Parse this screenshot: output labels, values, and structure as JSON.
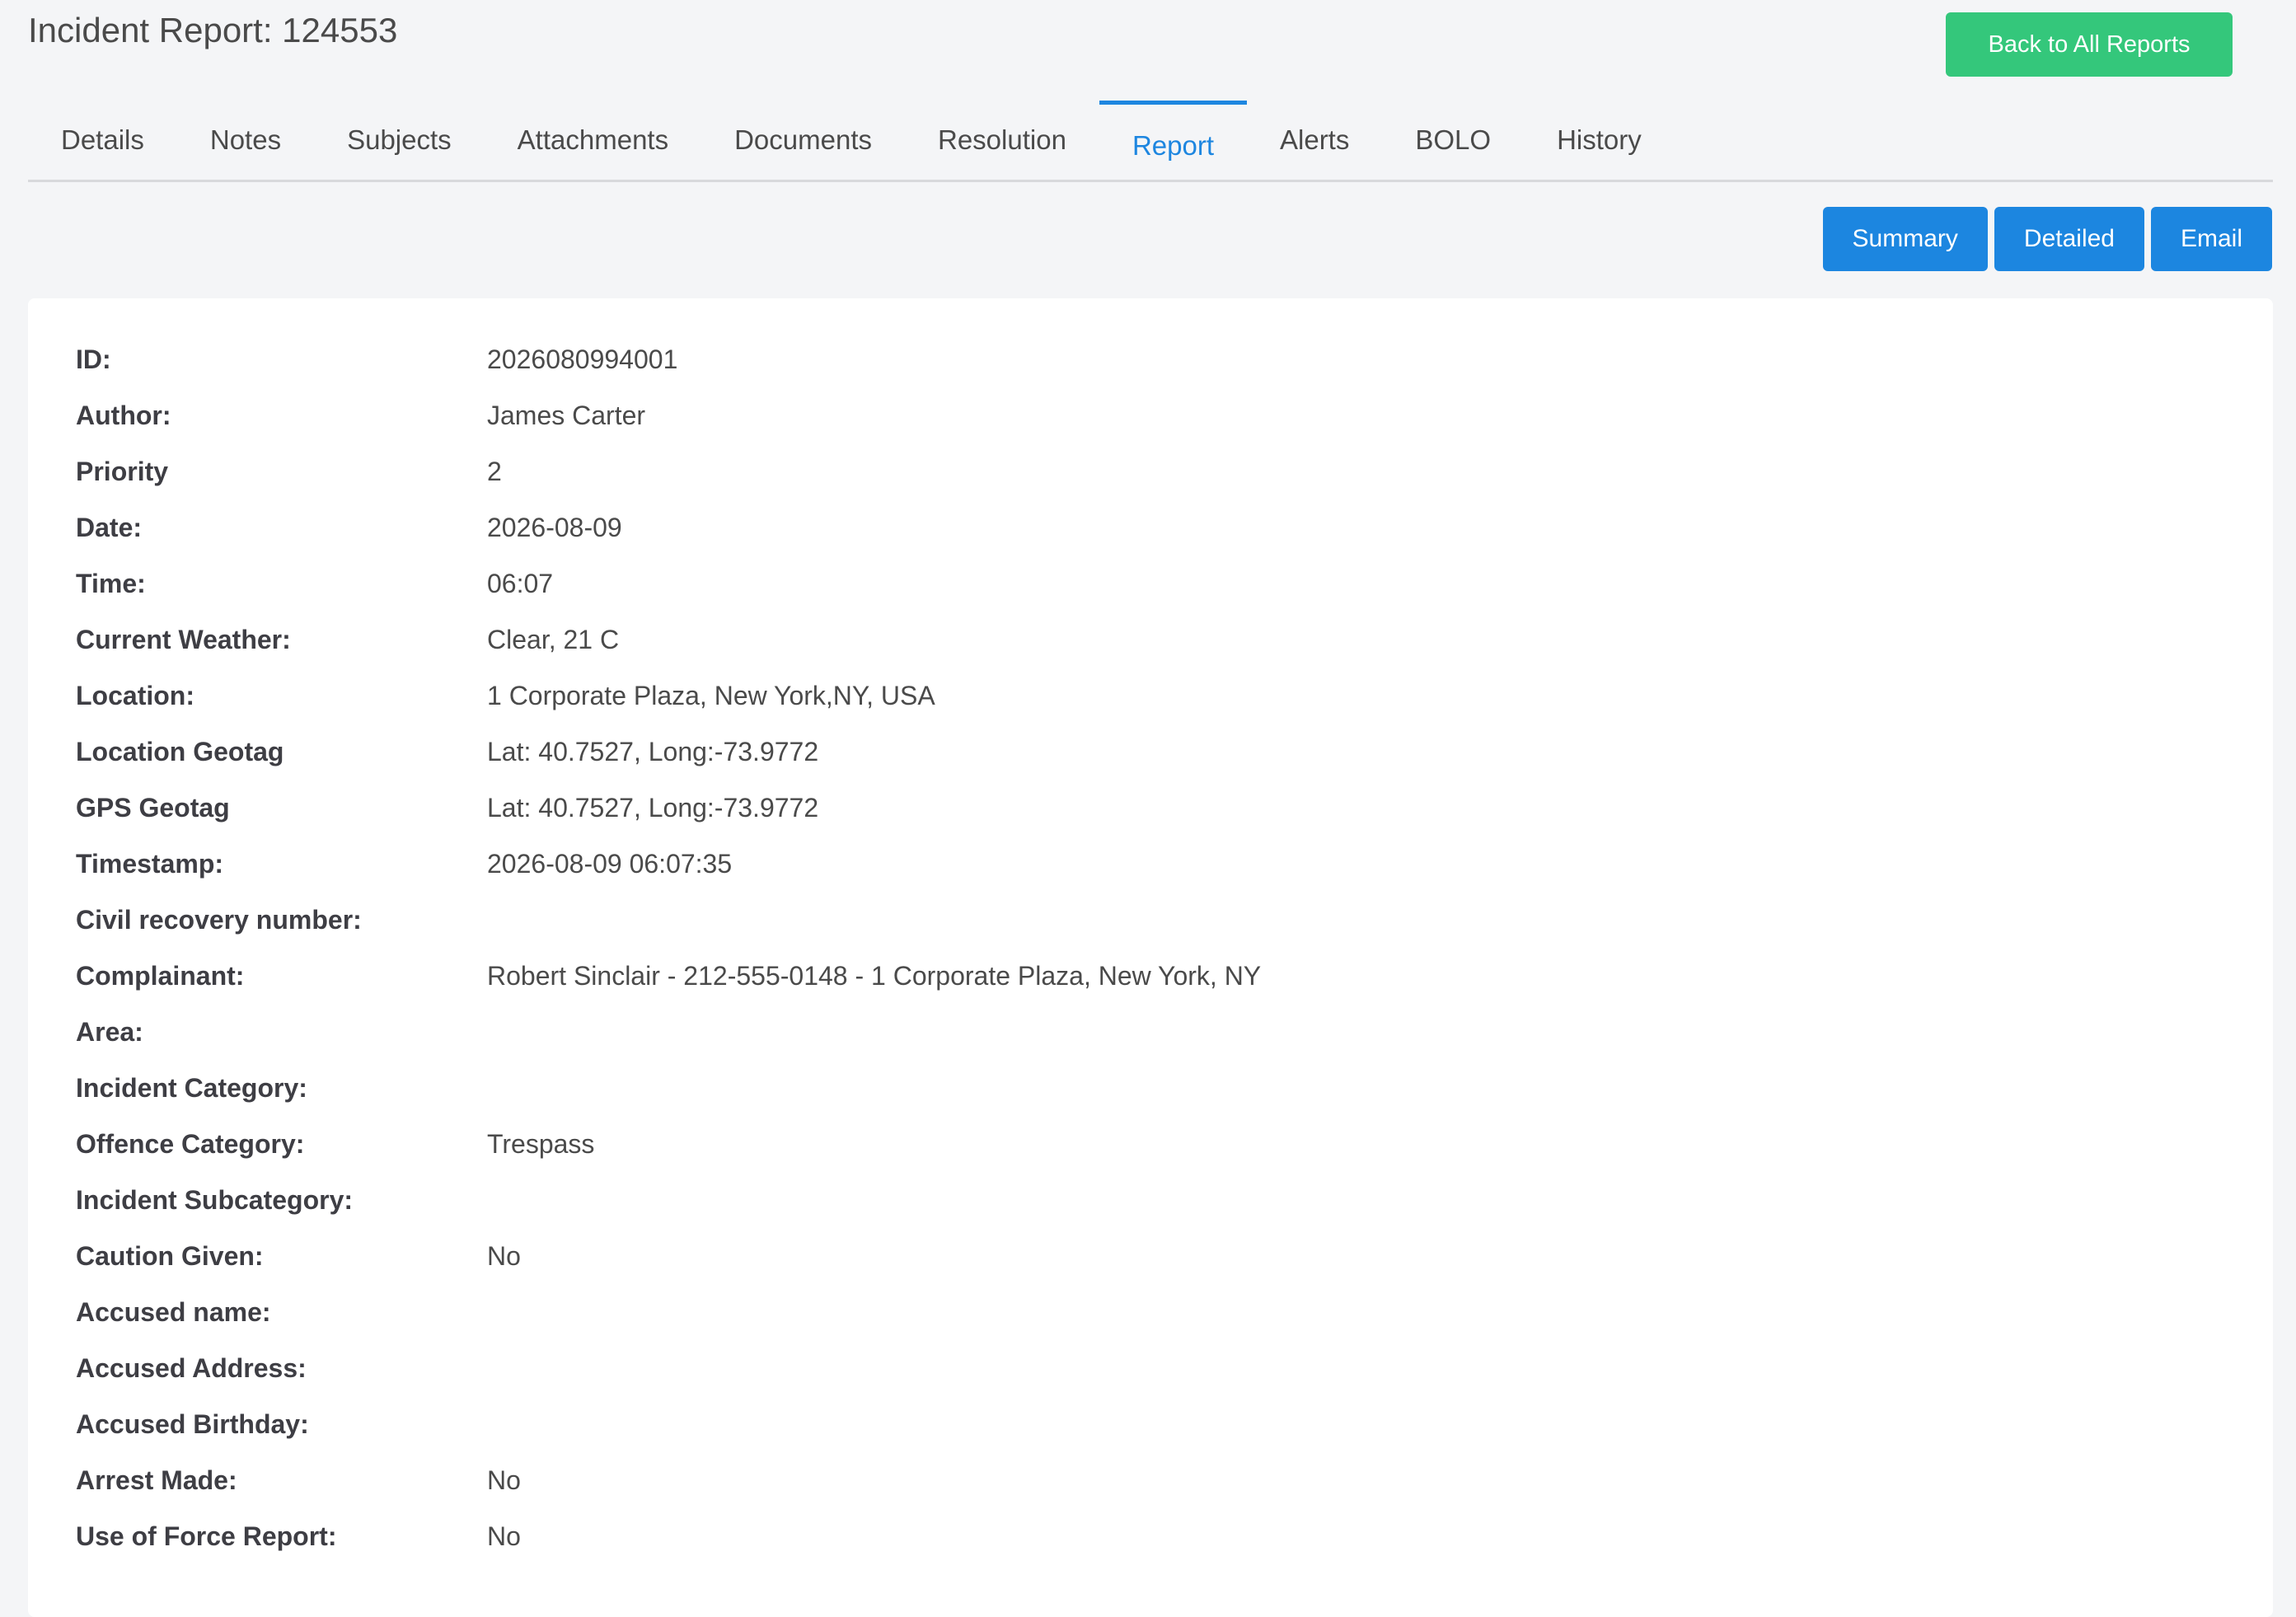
{
  "header": {
    "title": "Incident Report: 124553",
    "back_label": "Back to All Reports"
  },
  "tabs": [
    {
      "label": "Details"
    },
    {
      "label": "Notes"
    },
    {
      "label": "Subjects"
    },
    {
      "label": "Attachments"
    },
    {
      "label": "Documents"
    },
    {
      "label": "Resolution"
    },
    {
      "label": "Report",
      "active": true
    },
    {
      "label": "Alerts"
    },
    {
      "label": "BOLO"
    },
    {
      "label": "History"
    }
  ],
  "report_actions": {
    "summary": "Summary",
    "detailed": "Detailed",
    "email": "Email"
  },
  "fields": [
    {
      "label": "ID:",
      "value": "2026080994001"
    },
    {
      "label": "Author:",
      "value": "James Carter"
    },
    {
      "label": "Priority",
      "value": "2"
    },
    {
      "label": "Date:",
      "value": "2026-08-09"
    },
    {
      "label": "Time:",
      "value": "06:07"
    },
    {
      "label": "Current Weather:",
      "value": "Clear, 21 C"
    },
    {
      "label": "Location:",
      "value": "1 Corporate Plaza, New York,NY, USA"
    },
    {
      "label": "Location Geotag",
      "value": "Lat: 40.7527, Long:-73.9772"
    },
    {
      "label": "GPS Geotag",
      "value": "Lat: 40.7527, Long:-73.9772"
    },
    {
      "label": "Timestamp:",
      "value": "2026-08-09 06:07:35"
    },
    {
      "label": "Civil recovery number:",
      "value": ""
    },
    {
      "label": "Complainant:",
      "value": "Robert Sinclair - 212-555-0148 - 1 Corporate Plaza, New York, NY"
    },
    {
      "label": "Area:",
      "value": ""
    },
    {
      "label": "Incident Category:",
      "value": ""
    },
    {
      "label": "Offence Category:",
      "value": "Trespass"
    },
    {
      "label": "Incident Subcategory:",
      "value": ""
    },
    {
      "label": "Caution Given:",
      "value": "No"
    },
    {
      "label": "Accused name:",
      "value": ""
    },
    {
      "label": "Accused Address:",
      "value": ""
    },
    {
      "label": "Accused Birthday:",
      "value": ""
    },
    {
      "label": "Arrest Made:",
      "value": "No"
    },
    {
      "label": "Use of Force Report:",
      "value": "No"
    }
  ],
  "colors": {
    "accent": "#1c86e0",
    "success": "#34c77b",
    "background": "#f4f5f7"
  }
}
